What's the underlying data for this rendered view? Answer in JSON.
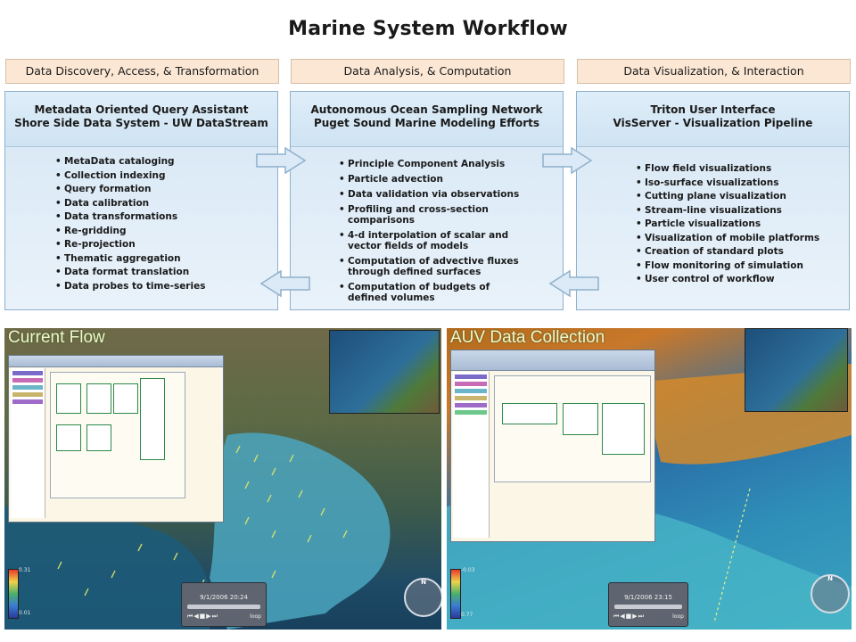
{
  "title": "Marine System Workflow",
  "columns": [
    {
      "header": "Data Discovery, Access, & Transformation",
      "subtitle_lines": [
        "Metadata Oriented Query Assistant",
        "Shore Side Data System - UW DataStream"
      ],
      "items": [
        "MetaData cataloging",
        "Collection indexing",
        "Query formation",
        "Data calibration",
        "Data transformations",
        "Re-gridding",
        "Re-projection",
        "Thematic aggregation",
        "Data format translation",
        "Data probes to time-series"
      ]
    },
    {
      "header": "Data Analysis, & Computation",
      "subtitle_lines": [
        "Autonomous Ocean Sampling Network",
        "Puget Sound Marine Modeling Efforts"
      ],
      "items": [
        "Principle Component Analysis",
        "Particle advection",
        "Data validation via observations",
        "Profiling and cross-section comparisons",
        "4-d interpolation of scalar and vector fields of models",
        "Computation of advective  fluxes through defined surfaces",
        "Computation of budgets of defined volumes"
      ]
    },
    {
      "header": "Data Visualization, & Interaction",
      "subtitle_lines": [
        "Triton User Interface",
        "VisServer - Visualization Pipeline"
      ],
      "items": [
        "Flow field visualizations",
        "Iso-surface visualizations",
        "Cutting plane visualization",
        "Stream-line visualizations",
        "Particle visualizations",
        "Visualization of mobile platforms",
        "Creation of standard plots",
        "Flow monitoring of simulation",
        "User control of workflow"
      ]
    }
  ],
  "screenshots": [
    {
      "title": "Current Flow",
      "timestamp": "9/1/2006 20:24",
      "loop_label": "loop",
      "legend_max": "0.31",
      "legend_min": "0.01",
      "compass_label": "N"
    },
    {
      "title": "AUV Data Collection",
      "timestamp": "9/1/2006 23:15",
      "loop_label": "loop",
      "legend_max": "-0.03",
      "legend_min": "0.77",
      "compass_label": "N"
    }
  ],
  "colors": {
    "header_bg": "#fbe7d4",
    "panel_bg": "#dbeaf6",
    "arrow_fill": "#dbeaf6",
    "arrow_stroke": "#8fb0cc"
  }
}
